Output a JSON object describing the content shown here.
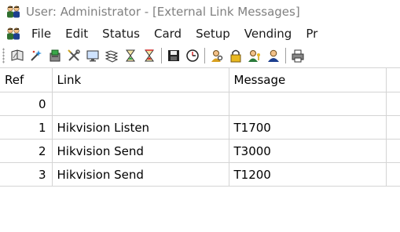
{
  "window": {
    "title": "User: Administrator - [External Link Messages]",
    "app_icon": "people-icon"
  },
  "menu": {
    "icon": "people-icon",
    "items": [
      {
        "label": "File"
      },
      {
        "label": "Edit"
      },
      {
        "label": "Status"
      },
      {
        "label": "Card"
      },
      {
        "label": "Setup"
      },
      {
        "label": "Vending"
      },
      {
        "label": "Pr"
      }
    ]
  },
  "toolbar": {
    "buttons": [
      "book-icon",
      "wand-icon",
      "card-reader-icon",
      "tools-icon",
      "monitor-icon",
      "sheets-icon",
      "hourglass-icon",
      "hourglass-red-icon",
      "save-icon",
      "clock-icon",
      "user-search-icon",
      "lock-icon",
      "user-key-icon",
      "user-icon",
      "printer-icon"
    ]
  },
  "grid": {
    "columns": [
      "Ref",
      "Link",
      "Message"
    ],
    "rows": [
      {
        "ref": "0",
        "link": "",
        "message": ""
      },
      {
        "ref": "1",
        "link": "Hikvision Listen",
        "message": "T1700"
      },
      {
        "ref": "2",
        "link": "Hikvision Send",
        "message": "T3000"
      },
      {
        "ref": "3",
        "link": "Hikvision Send",
        "message": "T1200"
      }
    ]
  }
}
